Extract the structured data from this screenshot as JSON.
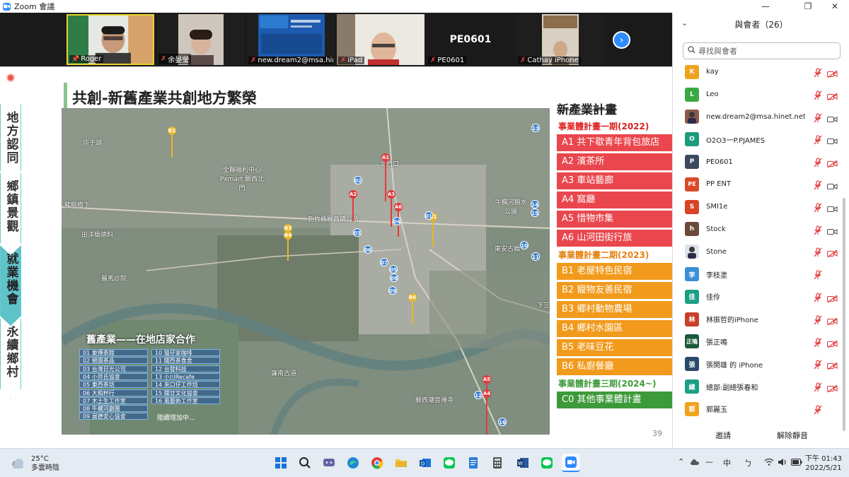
{
  "window": {
    "title": "Zoom 會議",
    "minimize_glyph": "—",
    "maximize_glyph": "❐",
    "close_glyph": "✕",
    "icon": "zoom-app-icon"
  },
  "video_tiles": [
    {
      "name": "Roger",
      "icon": "pin-icon"
    },
    {
      "name": "余晏瑩",
      "icon": "mic-muted-icon"
    },
    {
      "name": "new.dream2@msa.hin...",
      "icon": "mic-muted-icon"
    },
    {
      "name": "iPad",
      "icon": "mic-muted-icon"
    },
    {
      "name": "PE0601",
      "big_label": "PE0601",
      "icon": "mic-muted-icon"
    },
    {
      "name": "Cathay iPhone",
      "icon": "mic-muted-icon"
    }
  ],
  "slide": {
    "title": "共創-新舊產業共創地方繁榮",
    "nav": [
      "地方認同",
      "鄉鎮景觀",
      "就業機會",
      "永續鄉村"
    ],
    "page_number": "39",
    "map_labels": [
      "店子湖",
      "全聯福利中心 Pxmart 關西北門",
      "北門口",
      "龍眼樹下",
      "田洋橋德料",
      "新竹縣關西鎮公所",
      "牛欄河親水公園",
      "東安古橋",
      "羅馬診院",
      "下三",
      "濂南古道",
      "關西潮音禪寺"
    ],
    "old_industry": {
      "header": "舊產業——在地店家合作",
      "items": [
        "01 東傳茶館",
        "02 碧園茶品",
        "03 台灣日光公司",
        "04 小貝氏協會",
        "05 東西茶坊",
        "06 大和杯行",
        "07 木土生工作室",
        "08 牛欄河劇團",
        "09 展德安心協會",
        "10 猫仔家咖啡",
        "11 關西茶食舍",
        "12 台發科技",
        "13 小川Recafe",
        "14 來口仔工作坊",
        "15 關廿文化協會",
        "16 風藝術工作室"
      ],
      "more": "陸續增加中..."
    },
    "new_plan": {
      "heading": "新產業計畫",
      "phase1_title": "事業體計畫一期(2022)",
      "phase1": [
        "A1  共下歇青年背包旅店",
        "A2  濱茶所",
        "A3  車站藝廊",
        "A4  窩廳",
        "A5  惜物市集",
        "A6  山河田街行旅"
      ],
      "phase2_title": "事業體計畫二期(2023)",
      "phase2": [
        "B1  老屋特色民宿",
        "B2  寵物友善民宿",
        "B3  鄉村動物農場",
        "B4  鄉村水園區",
        "B5  老味豆花",
        "B6  私廚餐廳"
      ],
      "phase3_title": "事業體計畫三期(2024~)",
      "phase3": [
        "C0  其他事業體計畫"
      ]
    },
    "pins_red": [
      "A1",
      "A2",
      "A3",
      "A4",
      "A5",
      "A6"
    ],
    "pins_yellow": [
      "B1",
      "B2",
      "B3",
      "B4",
      "B6"
    ],
    "pins_blue": [
      "01",
      "02",
      "03",
      "04",
      "05",
      "06",
      "07",
      "08",
      "09",
      "10",
      "11",
      "12",
      "13",
      "14",
      "15",
      "16"
    ]
  },
  "participants": {
    "title": "與會者（26）",
    "search_placeholder": "尋找與會者",
    "list": [
      {
        "initial": "K",
        "color": "#f0a21f",
        "name": "kay",
        "cam": "camera-off-icon"
      },
      {
        "initial": "L",
        "color": "#3aa845",
        "name": "Leo",
        "cam": "camera-off-icon"
      },
      {
        "initial": "",
        "color": "#8a5a4a",
        "name": "new.dream2@msa.hinet.net",
        "cam": "camera-on-icon"
      },
      {
        "initial": "O",
        "color": "#1a9c7c",
        "name": "O2O3一P.PJAMES",
        "cam": "camera-on-icon"
      },
      {
        "initial": "P",
        "color": "#3b4a5e",
        "name": "PE0601",
        "cam": "camera-off-icon"
      },
      {
        "initial": "PE",
        "color": "#d94a2a",
        "name": "PP ENT",
        "cam": "camera-on-icon"
      },
      {
        "initial": "S",
        "color": "#d84424",
        "name": "SMI1e",
        "cam": "camera-on-icon"
      },
      {
        "initial": "h",
        "color": "#6b4a3a",
        "name": "Stock",
        "cam": "camera-on-icon"
      },
      {
        "initial": "",
        "color": "#dde3ea",
        "name": "Stone",
        "cam": "camera-off-icon"
      },
      {
        "initial": "李",
        "color": "#3a8fd8",
        "name": "李枝塗",
        "cam": ""
      },
      {
        "initial": "佳",
        "color": "#1ba087",
        "name": "佳伶",
        "cam": "camera-off-icon"
      },
      {
        "initial": "林",
        "color": "#c8402a",
        "name": "林振哲的iPhone",
        "cam": "camera-off-icon"
      },
      {
        "initial": "正鳴",
        "color": "#1a5a3a",
        "name": "張正鳴",
        "cam": "camera-off-icon"
      },
      {
        "initial": "張",
        "color": "#2a4a6a",
        "name": "張閔雄 的 iPhone",
        "cam": "camera-off-icon"
      },
      {
        "initial": "總",
        "color": "#1ba087",
        "name": "總部:副總張春和",
        "cam": "camera-off-icon"
      },
      {
        "initial": "郭",
        "color": "#f0a21f",
        "name": "郭麗玉",
        "cam": ""
      }
    ],
    "invite_label": "邀請",
    "unmute_label": "解除靜音"
  },
  "taskbar": {
    "temperature": "25°C",
    "weather": "多雲時陰",
    "ime": "中",
    "ime2": "ㄅ",
    "time": "下午 01:43",
    "date": "2022/5/21",
    "apps": [
      "start-icon",
      "search-icon",
      "chat-icon",
      "edge-icon",
      "chrome-icon",
      "folder-icon",
      "outlook-icon",
      "line-icon",
      "notepad-icon",
      "calculator-icon",
      "word-icon",
      "line-icon",
      "zoom-icon"
    ]
  },
  "colors": {
    "accent_blue": "#2d8cff",
    "phase1_red": "#e9474d",
    "phase2_orange": "#f19a1c",
    "phase3_green": "#3d9a3a",
    "phase1_text": "#e02020",
    "phase2_text": "#e5800e",
    "phase3_text": "#3d9a3a",
    "nav_active": "#5fc3c9"
  }
}
